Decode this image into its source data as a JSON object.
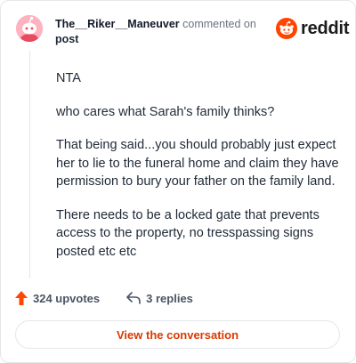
{
  "comment": {
    "author": "The__Riker__Maneuver",
    "action_text": "commented on",
    "target_link": "post",
    "paragraphs": [
      "NTA",
      "who cares what Sarah's family thinks?",
      "That being said...you should probably just expect her to lie to the funeral home and claim they have permission to bury your father on the family land.",
      "There needs to be a locked gate that prevents access to the property, no tresspassing signs posted etc etc"
    ]
  },
  "brand": {
    "wordmark": "reddit",
    "color": "#ff4500"
  },
  "actions": {
    "upvotes_label": "324 upvotes",
    "replies_label": "3 replies"
  },
  "footer": {
    "view_button_label": "View the conversation"
  },
  "icons": {
    "avatar": "snoo-avatar-icon",
    "logo": "reddit-snoo-icon",
    "upvote": "upvote-arrow-icon",
    "reply": "reply-arrow-icon"
  },
  "colors": {
    "accent": "#d93a00",
    "upvote": "#ff4500",
    "avatar_bg": "#ffb2bf"
  }
}
